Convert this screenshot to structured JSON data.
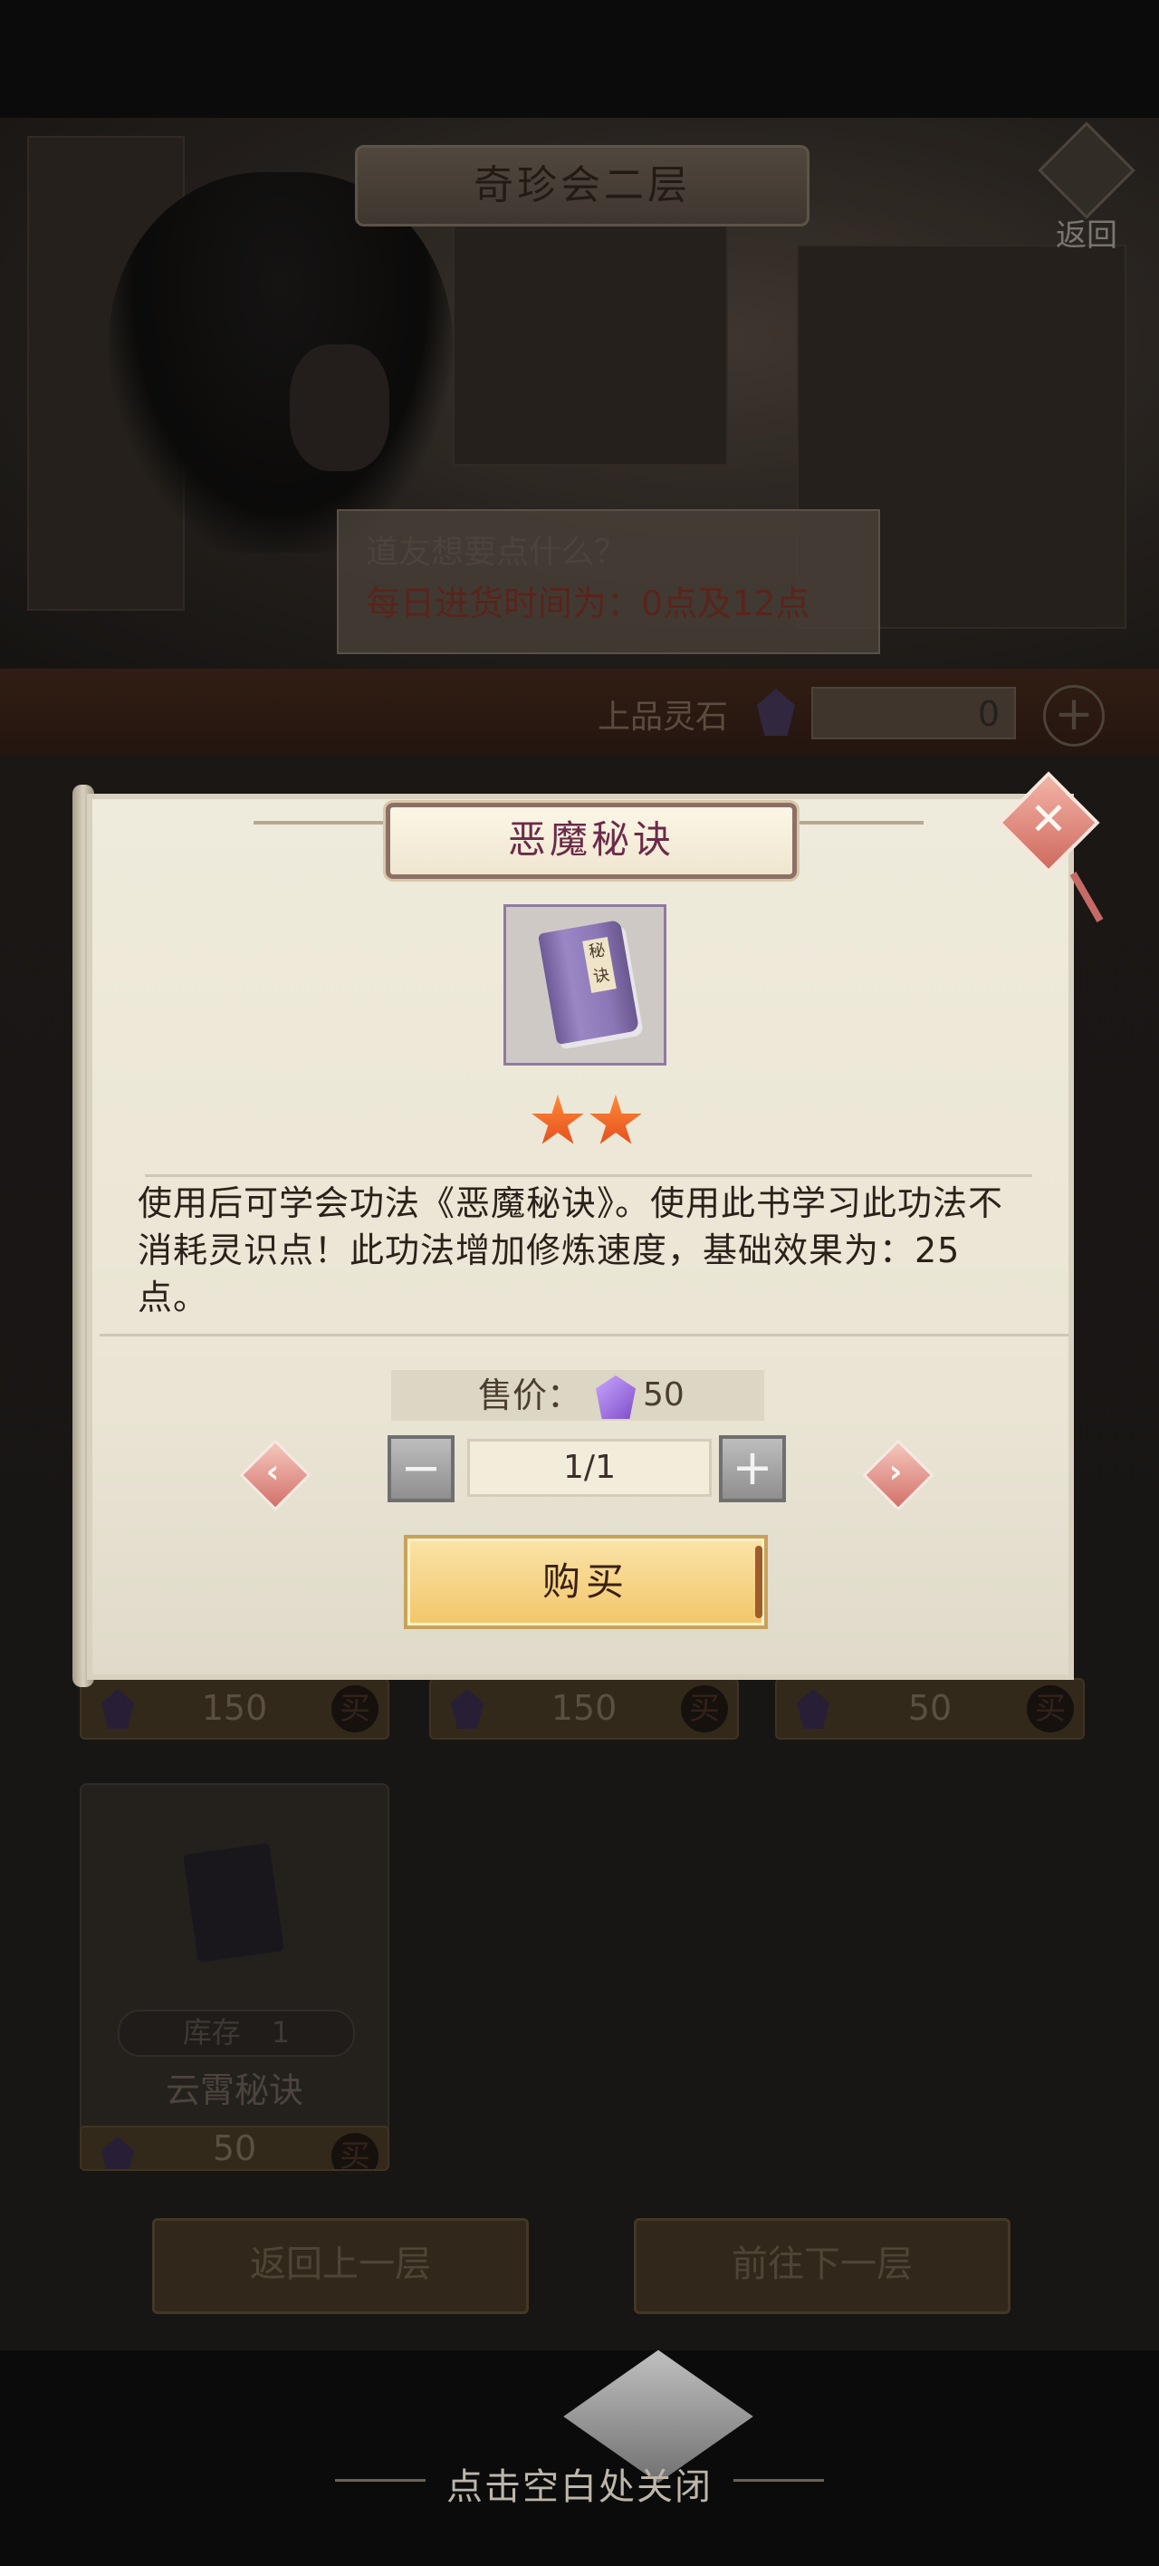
{
  "shop": {
    "title": "奇珍会二层",
    "back_label": "返回",
    "merchant_line1": "道友想要点什么？",
    "merchant_line2": "每日进货时间为：0点及12点",
    "currency_label": "上品灵石",
    "currency_amount": "0",
    "currency_plus": "+"
  },
  "grid_prices": [
    {
      "price": "150",
      "buy": "买"
    },
    {
      "price": "150",
      "buy": "买"
    },
    {
      "price": "50",
      "buy": "买"
    }
  ],
  "card_yunxiao": {
    "stock_label": "库存",
    "stock_value": "1",
    "name": "云霄秘诀",
    "price": "50",
    "buy": "买"
  },
  "nav": {
    "prev_floor": "返回上一层",
    "next_floor": "前往下一层"
  },
  "modal": {
    "title": "恶魔秘诀",
    "item_icon": "purple-book-icon",
    "item_book_label": "秘诀",
    "stars": 2,
    "description": "使用后可学会功法《恶魔秘诀》。使用此书学习此功法不消耗灵识点！此功法增加修炼速度，基础效果为：25点。",
    "price_label": "售价：",
    "price_value": "50",
    "quantity": "1/1",
    "minus": "−",
    "plus": "+",
    "buy_label": "购买"
  },
  "footer": {
    "close_hint": "点击空白处关闭"
  },
  "colors": {
    "modal_title": "#6b2a4a",
    "buy_button": "#f2c66a",
    "star": "#e24a1a",
    "gem": "#7f4cc9"
  }
}
